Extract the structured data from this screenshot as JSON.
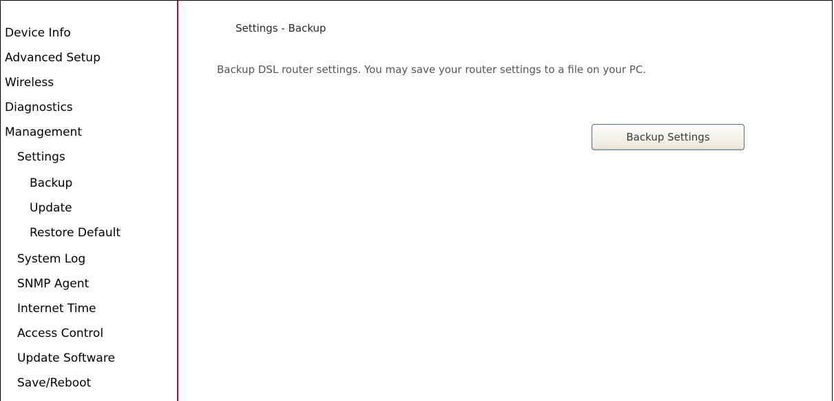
{
  "sidebar": {
    "items": [
      {
        "label": "Device Info",
        "level": 0
      },
      {
        "label": "Advanced Setup",
        "level": 0
      },
      {
        "label": "Wireless",
        "level": 0
      },
      {
        "label": "Diagnostics",
        "level": 0
      },
      {
        "label": "Management",
        "level": 0
      },
      {
        "label": "Settings",
        "level": 1
      },
      {
        "label": "Backup",
        "level": 2
      },
      {
        "label": "Update",
        "level": 2
      },
      {
        "label": "Restore Default",
        "level": 2
      },
      {
        "label": "System Log",
        "level": 1
      },
      {
        "label": "SNMP Agent",
        "level": 1
      },
      {
        "label": "Internet Time",
        "level": 1
      },
      {
        "label": "Access Control",
        "level": 1
      },
      {
        "label": "Update Software",
        "level": 1
      },
      {
        "label": "Save/Reboot",
        "level": 1
      }
    ]
  },
  "main": {
    "title": "Settings - Backup",
    "description": "Backup DSL router settings. You may save your router settings to a file on your PC.",
    "backup_button_label": "Backup Settings"
  },
  "colors": {
    "sidebar_divider": "#c0003a",
    "button_border": "#4a6e8e"
  }
}
